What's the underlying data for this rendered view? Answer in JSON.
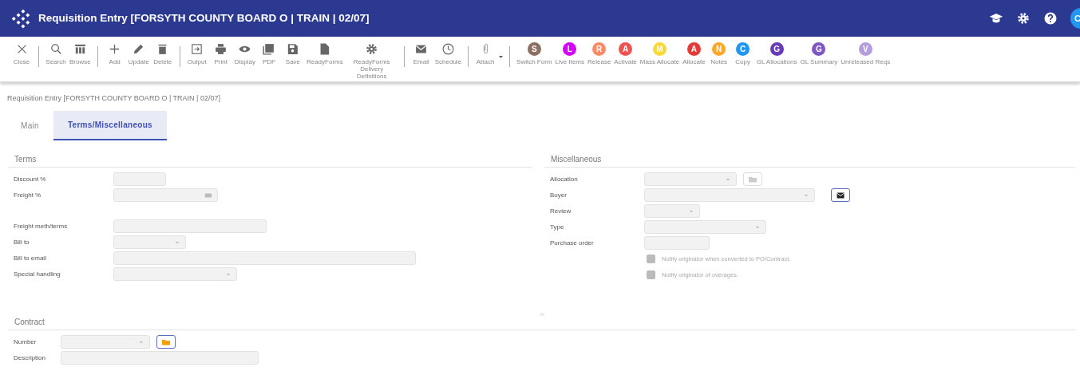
{
  "window": {
    "title": "Requisition Entry [FORSYTH COUNTY BOARD O | TRAIN | 02/07]"
  },
  "header": {
    "avatar": "C"
  },
  "toolbar": {
    "groups": [
      [
        {
          "label": "Close",
          "kind": "icon"
        }
      ],
      [
        {
          "label": "Search",
          "kind": "icon"
        },
        {
          "label": "Browse",
          "kind": "icon"
        }
      ],
      [
        {
          "label": "Add",
          "kind": "icon"
        },
        {
          "label": "Update",
          "kind": "icon"
        },
        {
          "label": "Delete",
          "kind": "icon"
        }
      ],
      [
        {
          "label": "Output",
          "kind": "icon"
        },
        {
          "label": "Print",
          "kind": "icon"
        },
        {
          "label": "Display",
          "kind": "icon"
        },
        {
          "label": "PDF",
          "kind": "icon"
        },
        {
          "label": "Save",
          "kind": "icon"
        },
        {
          "label": "ReadyForms",
          "kind": "icon"
        },
        {
          "label": "ReadyForms Delivery Definitions",
          "kind": "icon"
        }
      ],
      [
        {
          "label": "Email",
          "kind": "icon"
        },
        {
          "label": "Schedule",
          "kind": "icon"
        }
      ],
      [
        {
          "label": "Attach",
          "kind": "icon",
          "dropdown": true
        }
      ],
      [
        {
          "label": "Switch Form",
          "kind": "letter",
          "letter": "S",
          "color": "#8d6e63"
        },
        {
          "label": "Live Items",
          "kind": "letter",
          "letter": "L",
          "color": "#d500f9"
        },
        {
          "label": "Release",
          "kind": "letter",
          "letter": "R",
          "color": "#ff8a65"
        },
        {
          "label": "Activate",
          "kind": "letter",
          "letter": "A",
          "color": "#ef5350"
        },
        {
          "label": "Mass Allocate",
          "kind": "letter",
          "letter": "M",
          "color": "#fdd835"
        },
        {
          "label": "Allocate",
          "kind": "letter",
          "letter": "A",
          "color": "#e53935"
        },
        {
          "label": "Notes",
          "kind": "letter",
          "letter": "N",
          "color": "#ffa726"
        },
        {
          "label": "Copy",
          "kind": "letter",
          "letter": "C",
          "color": "#2196f3"
        },
        {
          "label": "GL Allocations",
          "kind": "letter",
          "letter": "G",
          "color": "#673ab7"
        },
        {
          "label": "GL Summary",
          "kind": "letter",
          "letter": "G",
          "color": "#7e57c2"
        },
        {
          "label": "Unreleased Reqs",
          "kind": "letter",
          "letter": "V",
          "color": "#b39ddb"
        }
      ]
    ]
  },
  "breadcrumb": "Requisition Entry [FORSYTH COUNTY BOARD O | TRAIN | 02/07]",
  "tabs": [
    {
      "label": "Main",
      "selected": false
    },
    {
      "label": "Terms/Miscellaneous",
      "selected": true
    }
  ],
  "terms": {
    "title": "Terms",
    "fields": [
      {
        "label": "Discount %",
        "kind": "text"
      },
      {
        "label": "Freight %",
        "kind": "calc"
      },
      {
        "label": "Freight meth/terms",
        "kind": "text"
      },
      {
        "label": "Bill to",
        "kind": "select"
      },
      {
        "label": "Bill to email",
        "kind": "text"
      },
      {
        "label": "Special handling",
        "kind": "select"
      }
    ]
  },
  "miscellaneous": {
    "title": "Miscellaneous",
    "fields": [
      {
        "label": "Allocation",
        "kind": "select",
        "action": {
          "disabled": true
        }
      },
      {
        "label": "Buyer",
        "kind": "select",
        "action": {
          "disabled": false
        }
      },
      {
        "label": "Review",
        "kind": "select"
      },
      {
        "label": "Type",
        "kind": "select"
      },
      {
        "label": "Purchase order",
        "kind": "text"
      }
    ],
    "checkboxes": [
      {
        "label": "Notify originator when converted to PO/Contract.",
        "disabled": true
      },
      {
        "label": "Notify originator of overages.",
        "disabled": true
      }
    ]
  },
  "contract": {
    "title": "Contract",
    "fields": [
      {
        "label": "Number",
        "kind": "select",
        "action": {
          "disabled": false
        }
      },
      {
        "label": "Description",
        "kind": "text"
      }
    ]
  }
}
